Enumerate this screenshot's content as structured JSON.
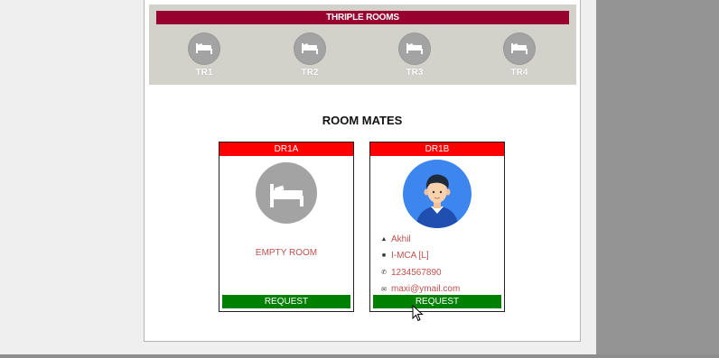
{
  "triple": {
    "header": "THRIPLE ROOMS",
    "rooms": [
      {
        "label": "TR1"
      },
      {
        "label": "TR2"
      },
      {
        "label": "TR3"
      },
      {
        "label": "TR4"
      }
    ]
  },
  "roommates": {
    "title": "ROOM MATES",
    "cards": [
      {
        "header": "DR1A",
        "empty_text": "EMPTY ROOM",
        "request_label": "REQUEST"
      },
      {
        "header": "DR1B",
        "name": "Akhil",
        "course": "I-MCA [L]",
        "phone": "1234567890",
        "email": "maxi@ymail.com",
        "request_label": "REQUEST"
      }
    ]
  },
  "colors": {
    "triple_header": "#98002e",
    "card_header": "#ff0000",
    "request_button": "#008000",
    "info_text": "#c0504d",
    "avatar_bg": "#3d86f0"
  },
  "icons": {
    "room": "bed-icon",
    "person": "user-icon",
    "course": "graduation-icon",
    "phone": "phone-icon",
    "email": "envelope-icon"
  }
}
